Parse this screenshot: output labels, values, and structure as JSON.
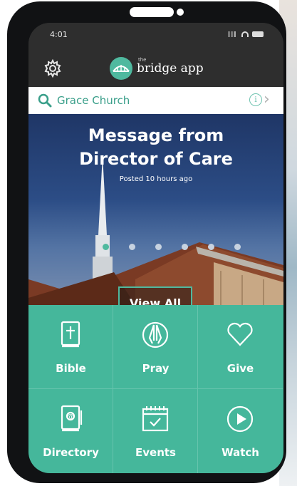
{
  "status_bar": {
    "time": "4:01"
  },
  "app_bar": {
    "logo_small": "the",
    "logo_text": "bridge app"
  },
  "search": {
    "value": "Grace Church",
    "info_glyph": "i",
    "chevron_glyph": "›"
  },
  "hero": {
    "title_line1": "Message from",
    "title_line2": "Director of Care",
    "subtitle": "Posted 10 hours ago",
    "carousel_dots": 6,
    "active_dot": 0,
    "view_all_label": "View All"
  },
  "grid": {
    "items": [
      {
        "label": "Bible",
        "icon": "bible-icon"
      },
      {
        "label": "Pray",
        "icon": "pray-icon"
      },
      {
        "label": "Give",
        "icon": "heart-icon"
      },
      {
        "label": "Directory",
        "icon": "directory-icon"
      },
      {
        "label": "Events",
        "icon": "calendar-icon"
      },
      {
        "label": "Watch",
        "icon": "play-icon"
      }
    ]
  },
  "colors": {
    "accent": "#45b79b",
    "app_bar": "#2e2e2e",
    "hero_sky": "#2c4d86"
  }
}
